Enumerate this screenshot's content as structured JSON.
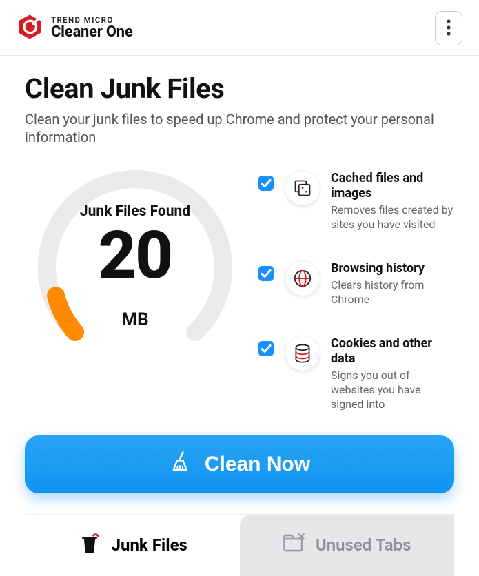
{
  "header": {
    "brand_top": "TREND MICRO",
    "brand_bottom": "Cleaner One"
  },
  "page": {
    "title": "Clean Junk Files",
    "subtitle": "Clean your junk files to speed up Chrome and protect your personal information"
  },
  "gauge": {
    "label": "Junk Files Found",
    "value": "20",
    "unit": "MB"
  },
  "options": [
    {
      "title": "Cached files and images",
      "desc": "Removes files created by sites you have visited",
      "checked": true
    },
    {
      "title": "Browsing history",
      "desc": "Clears history from Chrome",
      "checked": true
    },
    {
      "title": "Cookies and other data",
      "desc": "Signs you out of websites you have signed into",
      "checked": true
    }
  ],
  "actions": {
    "clean_label": "Clean Now"
  },
  "tabs": {
    "junk": "Junk Files",
    "unused": "Unused Tabs"
  },
  "colors": {
    "accent_blue": "#1890ff",
    "accent_orange": "#ff8a00",
    "brand_red": "#d71920"
  }
}
